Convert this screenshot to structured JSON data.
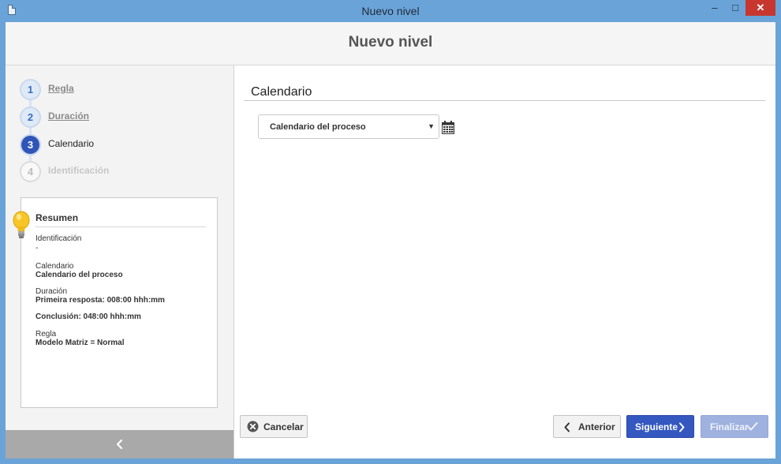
{
  "window": {
    "title": "Nuevo nivel",
    "minimize_label": "–",
    "maximize_label": "□",
    "close_label": "✕"
  },
  "header": {
    "title": "Nuevo nivel"
  },
  "steps": [
    {
      "number": "1",
      "label": "Regla",
      "state": "done"
    },
    {
      "number": "2",
      "label": "Duración",
      "state": "done"
    },
    {
      "number": "3",
      "label": "Calendario",
      "state": "active"
    },
    {
      "number": "4",
      "label": "Identificación",
      "state": "disabled"
    }
  ],
  "summary": {
    "title": "Resumen",
    "identificacion_label": "Identificación",
    "identificacion_value": "-",
    "calendario_label": "Calendario",
    "calendario_value": "Calendario del proceso",
    "duracion_label": "Duración",
    "duracion_primera": "Primeira resposta: 008:00 hhh:mm",
    "duracion_conclusion": "Conclusión: 048:00 hhh:mm",
    "regla_label": "Regla",
    "regla_value": "Modelo Matriz = Normal"
  },
  "main": {
    "section_title": "Calendario",
    "calendar_select_value": "Calendario del proceso"
  },
  "footer": {
    "cancel_label": "Cancelar",
    "previous_label": "Anterior",
    "next_label": "Siguiente",
    "finish_label": "Finalizar"
  },
  "colors": {
    "titlebar": "#6aa3d8",
    "primary_button": "#3458c0",
    "disabled_button": "#9fb1de",
    "active_step": "#2f55b7"
  },
  "icons": {
    "doc": "document-icon",
    "calendar": "calendar-icon",
    "bulb": "lightbulb-icon",
    "collapse": "chevron-left-icon"
  }
}
